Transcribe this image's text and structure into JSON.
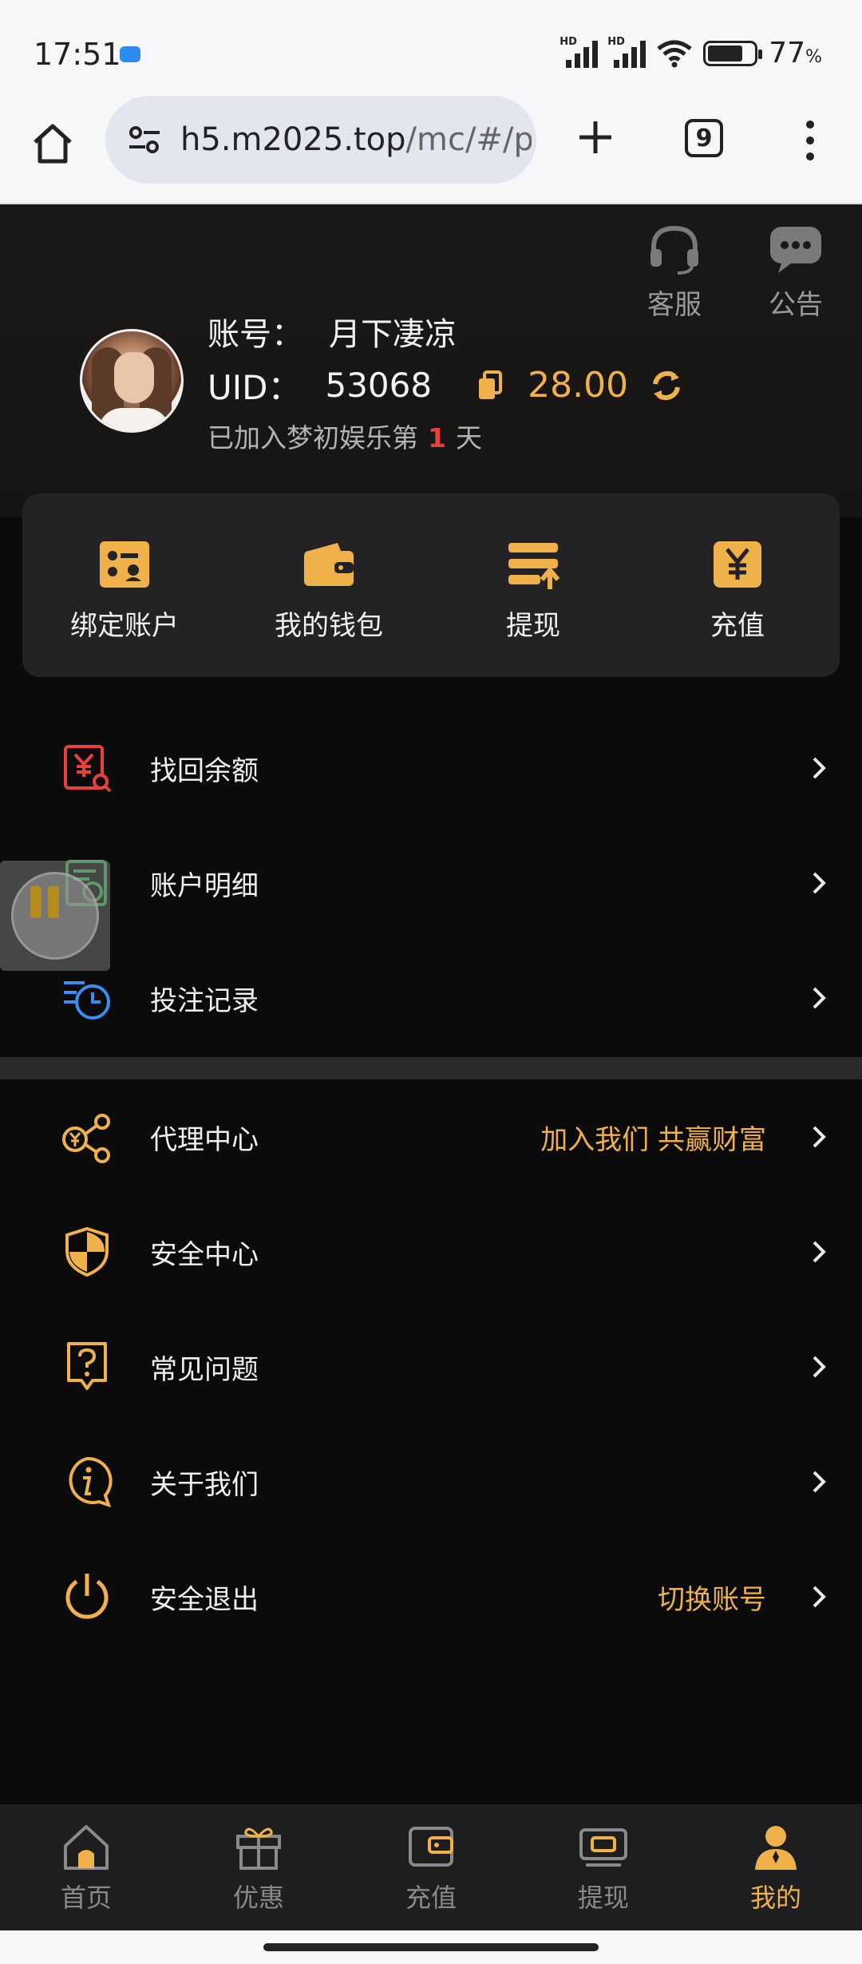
{
  "status_bar": {
    "time": "17:51",
    "battery_percent": "77",
    "battery_unit": "%",
    "signal_label": "HD"
  },
  "browser": {
    "url_main": "h5.m2025.top",
    "url_path": "/mc/#/p",
    "tab_count": "9"
  },
  "header": {
    "service_label": "客服",
    "notice_label": "公告",
    "account_prefix": "账号：",
    "account_name": "月下凄凉",
    "uid_prefix": "UID：",
    "uid_value": "53068",
    "balance": "28.00",
    "joined_prefix": "已加入梦初娱乐第",
    "joined_days": "1",
    "joined_suffix": "天"
  },
  "actions": [
    {
      "label": "绑定账户",
      "icon": "bind-account-icon"
    },
    {
      "label": "我的钱包",
      "icon": "wallet-icon"
    },
    {
      "label": "提现",
      "icon": "withdraw-icon"
    },
    {
      "label": "充值",
      "icon": "recharge-icon"
    }
  ],
  "menu_group_1": [
    {
      "label": "找回余额",
      "icon": "recover-balance-icon"
    },
    {
      "label": "账户明细",
      "icon": "account-detail-icon"
    },
    {
      "label": "投注记录",
      "icon": "bet-record-icon"
    }
  ],
  "menu_group_2": [
    {
      "label": "代理中心",
      "icon": "agent-icon",
      "extra": "加入我们 共赢财富"
    },
    {
      "label": "安全中心",
      "icon": "shield-icon",
      "extra": ""
    },
    {
      "label": "常见问题",
      "icon": "faq-icon",
      "extra": ""
    },
    {
      "label": "关于我们",
      "icon": "info-icon",
      "extra": ""
    },
    {
      "label": "安全退出",
      "icon": "power-icon",
      "extra": "切换账号"
    }
  ],
  "bottom_nav": [
    {
      "label": "首页",
      "icon": "home-icon"
    },
    {
      "label": "优惠",
      "icon": "gift-icon"
    },
    {
      "label": "充值",
      "icon": "recharge-wallet-icon"
    },
    {
      "label": "提现",
      "icon": "withdraw-card-icon"
    },
    {
      "label": "我的",
      "icon": "user-icon",
      "active": true
    }
  ],
  "colors": {
    "accent": "#f0b14a",
    "background": "#0b0b0c",
    "card": "#232325",
    "highlight_red": "#e8413b"
  }
}
